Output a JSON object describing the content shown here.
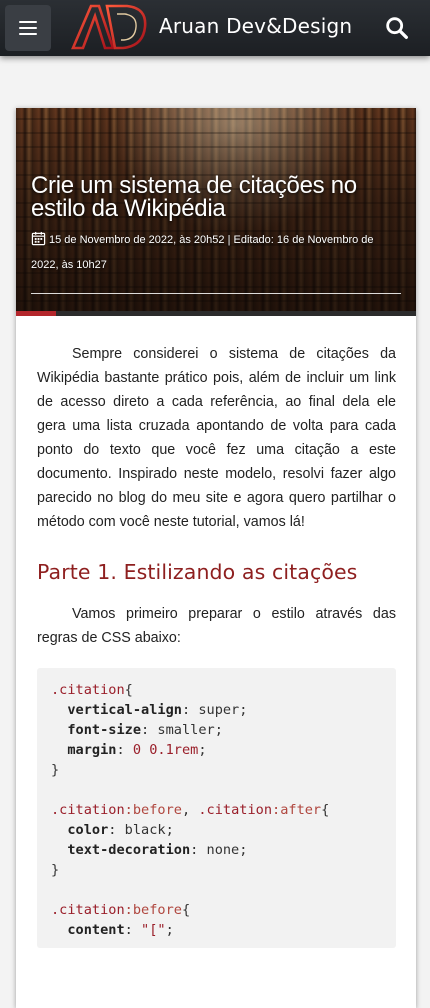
{
  "header": {
    "brand": "Aruan Dev&Design",
    "logo_text": "AD",
    "menu_icon": "hamburger-icon",
    "search_icon": "search-icon"
  },
  "article": {
    "title": "Crie um sistema de citações no estilo da Wikipédia",
    "meta": "15 de Novembro de 2022, às 20h52 | Editado: 16 de Novembro de 2022, às 10h27",
    "calendar_icon": "calendar-icon",
    "intro": "Sempre considerei o sistema de citações da Wikipédia bastante prático pois, além de incluir um link de acesso direto a cada referência, ao final dela ele gera uma lista cruzada apontando de volta para cada ponto do texto que você fez uma citação a este documento. Inspirado neste modelo, resolvi fazer algo parecido no blog do meu site e agora quero partilhar o método com você neste tutorial, vamos lá!",
    "section1_heading": "Parte 1. Estilizando as citações",
    "section1_text": "Vamos primeiro preparar o estilo através das regras de CSS abaixo:",
    "reading_progress": 0.1
  },
  "code_block": {
    "lines": [
      [
        {
          "t": ".citation",
          "c": "sel"
        },
        {
          "t": "{",
          "c": "pun"
        }
      ],
      [
        {
          "t": "  ",
          "c": "pun"
        },
        {
          "t": "vertical-align",
          "c": "prop"
        },
        {
          "t": ": super;",
          "c": "val"
        }
      ],
      [
        {
          "t": "  ",
          "c": "pun"
        },
        {
          "t": "font-size",
          "c": "prop"
        },
        {
          "t": ": smaller;",
          "c": "val"
        }
      ],
      [
        {
          "t": "  ",
          "c": "pun"
        },
        {
          "t": "margin",
          "c": "prop"
        },
        {
          "t": ": ",
          "c": "val"
        },
        {
          "t": "0 0.1rem",
          "c": "num"
        },
        {
          "t": ";",
          "c": "val"
        }
      ],
      [
        {
          "t": "}",
          "c": "pun"
        }
      ],
      [
        {
          "t": "",
          "c": "pun"
        }
      ],
      [
        {
          "t": ".citation",
          "c": "sel"
        },
        {
          "t": ":before",
          "c": "pseudo"
        },
        {
          "t": ", ",
          "c": "pun"
        },
        {
          "t": ".citation",
          "c": "sel"
        },
        {
          "t": ":after",
          "c": "pseudo"
        },
        {
          "t": "{",
          "c": "pun"
        }
      ],
      [
        {
          "t": "  ",
          "c": "pun"
        },
        {
          "t": "color",
          "c": "prop"
        },
        {
          "t": ": black;",
          "c": "val"
        }
      ],
      [
        {
          "t": "  ",
          "c": "pun"
        },
        {
          "t": "text-decoration",
          "c": "prop"
        },
        {
          "t": ": none;",
          "c": "val"
        }
      ],
      [
        {
          "t": "}",
          "c": "pun"
        }
      ],
      [
        {
          "t": "",
          "c": "pun"
        }
      ],
      [
        {
          "t": ".citation",
          "c": "sel"
        },
        {
          "t": ":before",
          "c": "pseudo"
        },
        {
          "t": "{",
          "c": "pun"
        }
      ],
      [
        {
          "t": "  ",
          "c": "pun"
        },
        {
          "t": "content",
          "c": "prop"
        },
        {
          "t": ": ",
          "c": "val"
        },
        {
          "t": "\"[\"",
          "c": "str"
        },
        {
          "t": ";",
          "c": "val"
        }
      ]
    ]
  },
  "colors": {
    "accent": "#8e1f1f",
    "progress": "#b3262b",
    "topbar": "#23272b"
  }
}
